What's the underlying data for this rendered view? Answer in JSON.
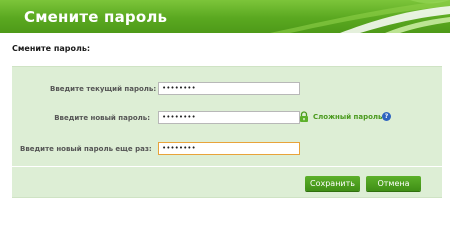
{
  "header": {
    "title": "Смените пароль"
  },
  "section": {
    "label": "Смените пароль:"
  },
  "form": {
    "current_password": {
      "label": "Введите текущий пароль:",
      "value": "••••••••"
    },
    "new_password": {
      "label": "Введите новый пароль:",
      "value": "••••••••"
    },
    "confirm_password": {
      "label": "Введите новый пароль еще раз:",
      "value": "••••••••"
    },
    "strength": {
      "label": "Сложный пароль",
      "icon": "lock-icon",
      "help_icon": "question-mark-icon"
    }
  },
  "buttons": {
    "save": "Сохранить",
    "cancel": "Отмена"
  },
  "colors": {
    "header_green": "#5aa820",
    "panel_bg": "#ddeed5",
    "button_green": "#4a9a1e",
    "focus_border": "#e8a33a",
    "help_blue": "#2e64c0"
  }
}
